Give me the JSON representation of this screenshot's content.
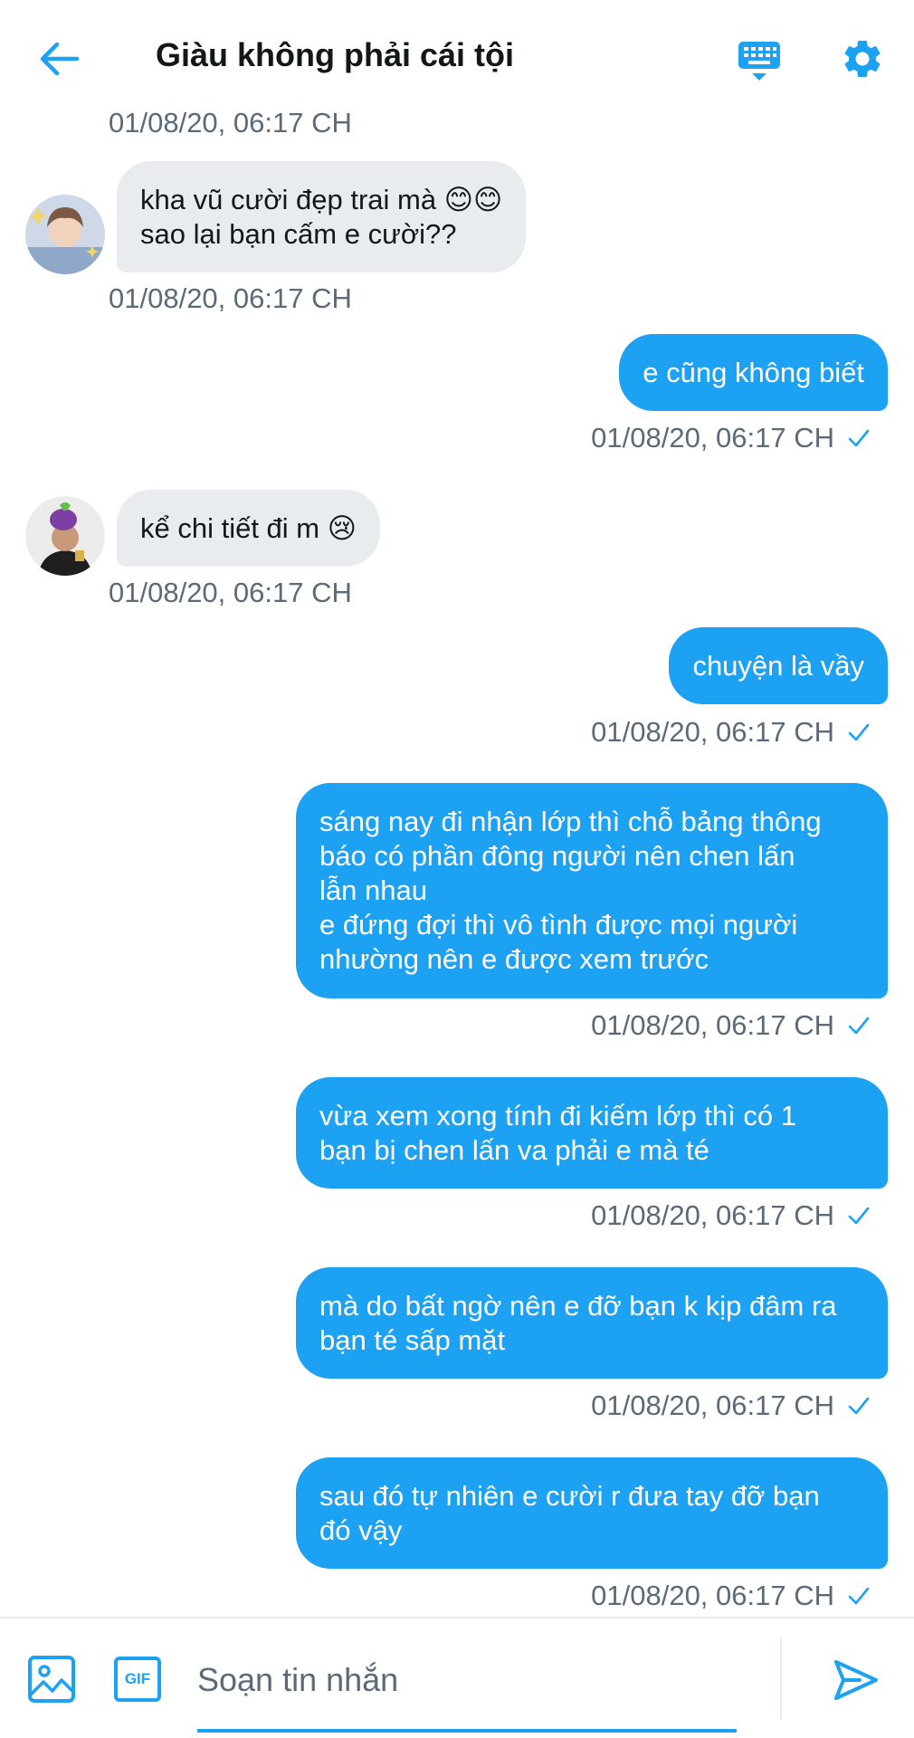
{
  "header": {
    "title": "Giàu không phải cái tội"
  },
  "messages": [
    {
      "timestamp": "01/08/20, 06:17 CH"
    },
    {
      "lines": [
        "kha vũ cười đẹp trai mà 😊😊",
        "sao lại bạn cấm e cười??"
      ],
      "timestamp": "01/08/20, 06:17 CH"
    },
    {
      "lines": [
        "e cũng không biết"
      ],
      "timestamp": "01/08/20, 06:17 CH"
    },
    {
      "lines": [
        "kể chi tiết đi m 😢"
      ],
      "timestamp": "01/08/20, 06:17 CH"
    },
    {
      "lines": [
        "chuyện là vầy"
      ],
      "timestamp": "01/08/20, 06:17 CH"
    },
    {
      "lines": [
        "sáng nay đi nhận lớp thì chỗ bảng thông",
        "báo có phần đông người nên chen lấn",
        "lẫn nhau",
        "e đứng đợi thì vô tình được mọi người",
        "nhường nên e được xem trước"
      ],
      "timestamp": "01/08/20, 06:17 CH"
    },
    {
      "lines": [
        "vừa xem xong tính đi kiếm lớp thì có 1",
        "bạn bị chen lấn va phải e mà té"
      ],
      "timestamp": "01/08/20, 06:17 CH"
    },
    {
      "lines": [
        "mà do bất ngờ nên e đỡ bạn k kịp đâm ra",
        "bạn té sấp mặt"
      ],
      "timestamp": "01/08/20, 06:17 CH"
    },
    {
      "lines": [
        "sau đó tự nhiên e cười r đưa tay đỡ bạn",
        "đó vậy"
      ],
      "timestamp": "01/08/20, 06:17 CH"
    }
  ],
  "composer": {
    "placeholder": "Soạn tin nhắn",
    "gif_label": "GIF"
  },
  "colors": {
    "accent": "#1da1f2",
    "incoming_bubble": "#e8ecef",
    "timestamp": "#5b6a78"
  },
  "icons": [
    "back-arrow-icon",
    "keyboard-icon",
    "gear-icon",
    "image-icon",
    "gif-icon",
    "send-icon",
    "read-check-icon"
  ]
}
